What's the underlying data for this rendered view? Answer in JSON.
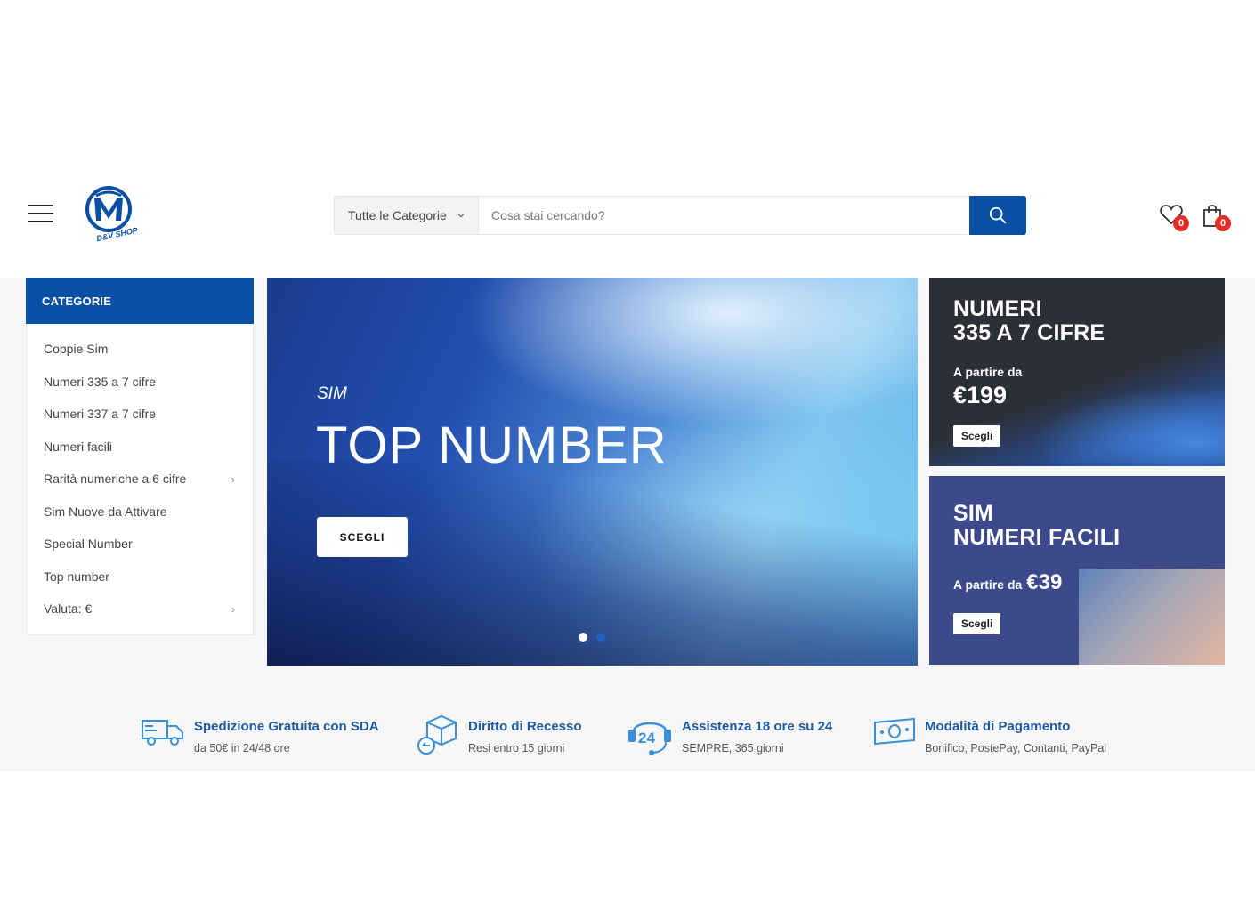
{
  "header": {
    "logo_text": "D&V SHOP",
    "search": {
      "category_label": "Tutte le Categorie",
      "placeholder": "Cosa stai cercando?"
    },
    "wishlist_count": "0",
    "cart_count": "0"
  },
  "sidebar": {
    "title": "CATEGORIE",
    "items": [
      {
        "label": "Coppie Sim",
        "arrow": ""
      },
      {
        "label": "Numeri 335 a 7 cifre",
        "arrow": ""
      },
      {
        "label": "Numeri 337 a 7 cifre",
        "arrow": ""
      },
      {
        "label": "Numeri facili",
        "arrow": ""
      },
      {
        "label": "Rarità numeriche a 6 cifre",
        "arrow": "›"
      },
      {
        "label": "Sim Nuove da Attivare",
        "arrow": ""
      },
      {
        "label": "Special Number",
        "arrow": ""
      },
      {
        "label": "Top number",
        "arrow": ""
      },
      {
        "label": "Valuta: €",
        "arrow": "›"
      }
    ]
  },
  "hero": {
    "subtitle": "SIM",
    "title": "TOP NUMBER",
    "button": "SCEGLI",
    "slides_total": 2,
    "active_slide": 1
  },
  "promos": [
    {
      "title_line1": "NUMERI",
      "title_line2": "335 A 7 CIFRE",
      "from": "A partire da",
      "price": "€199",
      "button": "Scegli"
    },
    {
      "title_line1": "SIM",
      "title_line2": "NUMERI FACILI",
      "from": "A partire da",
      "price": "€39",
      "button": "Scegli"
    }
  ],
  "features": [
    {
      "icon": "truck-icon",
      "title": "Spedizione Gratuita con SDA",
      "desc": "da 50€ in 24/48 ore"
    },
    {
      "icon": "return-box-icon",
      "title": "Diritto di Recesso",
      "desc": "Resi entro 15 giorni"
    },
    {
      "icon": "support-24-icon",
      "title": "Assistenza 18 ore su 24",
      "desc": "SEMPRE, 365 giorni"
    },
    {
      "icon": "money-icon",
      "title": "Modalità di Pagamento",
      "desc": "Bonifico, PostePay, Contanti, PayPal"
    }
  ],
  "colors": {
    "brand": "#0750a4",
    "badge": "#e52d27",
    "feature_title": "#1f5aa3",
    "band_bg": "#f7f7f7"
  }
}
